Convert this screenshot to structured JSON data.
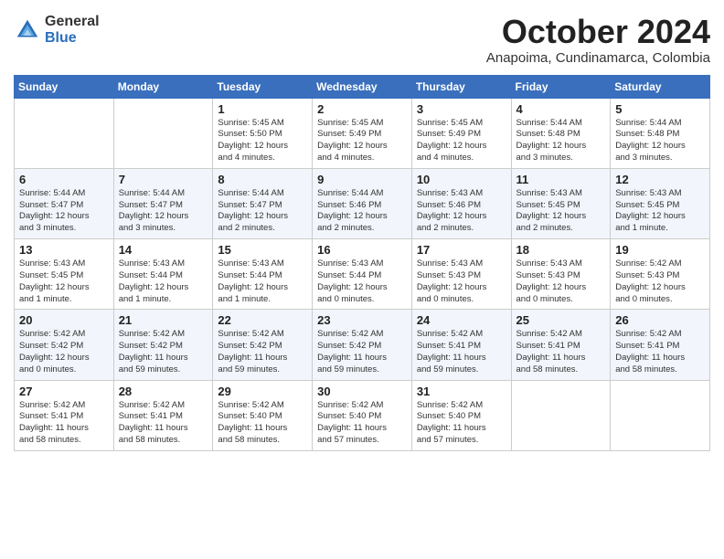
{
  "logo": {
    "general": "General",
    "blue": "Blue"
  },
  "title": "October 2024",
  "location": "Anapoima, Cundinamarca, Colombia",
  "weekdays": [
    "Sunday",
    "Monday",
    "Tuesday",
    "Wednesday",
    "Thursday",
    "Friday",
    "Saturday"
  ],
  "weeks": [
    [
      {
        "day": "",
        "detail": ""
      },
      {
        "day": "",
        "detail": ""
      },
      {
        "day": "1",
        "detail": "Sunrise: 5:45 AM\nSunset: 5:50 PM\nDaylight: 12 hours\nand 4 minutes."
      },
      {
        "day": "2",
        "detail": "Sunrise: 5:45 AM\nSunset: 5:49 PM\nDaylight: 12 hours\nand 4 minutes."
      },
      {
        "day": "3",
        "detail": "Sunrise: 5:45 AM\nSunset: 5:49 PM\nDaylight: 12 hours\nand 4 minutes."
      },
      {
        "day": "4",
        "detail": "Sunrise: 5:44 AM\nSunset: 5:48 PM\nDaylight: 12 hours\nand 3 minutes."
      },
      {
        "day": "5",
        "detail": "Sunrise: 5:44 AM\nSunset: 5:48 PM\nDaylight: 12 hours\nand 3 minutes."
      }
    ],
    [
      {
        "day": "6",
        "detail": "Sunrise: 5:44 AM\nSunset: 5:47 PM\nDaylight: 12 hours\nand 3 minutes."
      },
      {
        "day": "7",
        "detail": "Sunrise: 5:44 AM\nSunset: 5:47 PM\nDaylight: 12 hours\nand 3 minutes."
      },
      {
        "day": "8",
        "detail": "Sunrise: 5:44 AM\nSunset: 5:47 PM\nDaylight: 12 hours\nand 2 minutes."
      },
      {
        "day": "9",
        "detail": "Sunrise: 5:44 AM\nSunset: 5:46 PM\nDaylight: 12 hours\nand 2 minutes."
      },
      {
        "day": "10",
        "detail": "Sunrise: 5:43 AM\nSunset: 5:46 PM\nDaylight: 12 hours\nand 2 minutes."
      },
      {
        "day": "11",
        "detail": "Sunrise: 5:43 AM\nSunset: 5:45 PM\nDaylight: 12 hours\nand 2 minutes."
      },
      {
        "day": "12",
        "detail": "Sunrise: 5:43 AM\nSunset: 5:45 PM\nDaylight: 12 hours\nand 1 minute."
      }
    ],
    [
      {
        "day": "13",
        "detail": "Sunrise: 5:43 AM\nSunset: 5:45 PM\nDaylight: 12 hours\nand 1 minute."
      },
      {
        "day": "14",
        "detail": "Sunrise: 5:43 AM\nSunset: 5:44 PM\nDaylight: 12 hours\nand 1 minute."
      },
      {
        "day": "15",
        "detail": "Sunrise: 5:43 AM\nSunset: 5:44 PM\nDaylight: 12 hours\nand 1 minute."
      },
      {
        "day": "16",
        "detail": "Sunrise: 5:43 AM\nSunset: 5:44 PM\nDaylight: 12 hours\nand 0 minutes."
      },
      {
        "day": "17",
        "detail": "Sunrise: 5:43 AM\nSunset: 5:43 PM\nDaylight: 12 hours\nand 0 minutes."
      },
      {
        "day": "18",
        "detail": "Sunrise: 5:43 AM\nSunset: 5:43 PM\nDaylight: 12 hours\nand 0 minutes."
      },
      {
        "day": "19",
        "detail": "Sunrise: 5:42 AM\nSunset: 5:43 PM\nDaylight: 12 hours\nand 0 minutes."
      }
    ],
    [
      {
        "day": "20",
        "detail": "Sunrise: 5:42 AM\nSunset: 5:42 PM\nDaylight: 12 hours\nand 0 minutes."
      },
      {
        "day": "21",
        "detail": "Sunrise: 5:42 AM\nSunset: 5:42 PM\nDaylight: 11 hours\nand 59 minutes."
      },
      {
        "day": "22",
        "detail": "Sunrise: 5:42 AM\nSunset: 5:42 PM\nDaylight: 11 hours\nand 59 minutes."
      },
      {
        "day": "23",
        "detail": "Sunrise: 5:42 AM\nSunset: 5:42 PM\nDaylight: 11 hours\nand 59 minutes."
      },
      {
        "day": "24",
        "detail": "Sunrise: 5:42 AM\nSunset: 5:41 PM\nDaylight: 11 hours\nand 59 minutes."
      },
      {
        "day": "25",
        "detail": "Sunrise: 5:42 AM\nSunset: 5:41 PM\nDaylight: 11 hours\nand 58 minutes."
      },
      {
        "day": "26",
        "detail": "Sunrise: 5:42 AM\nSunset: 5:41 PM\nDaylight: 11 hours\nand 58 minutes."
      }
    ],
    [
      {
        "day": "27",
        "detail": "Sunrise: 5:42 AM\nSunset: 5:41 PM\nDaylight: 11 hours\nand 58 minutes."
      },
      {
        "day": "28",
        "detail": "Sunrise: 5:42 AM\nSunset: 5:41 PM\nDaylight: 11 hours\nand 58 minutes."
      },
      {
        "day": "29",
        "detail": "Sunrise: 5:42 AM\nSunset: 5:40 PM\nDaylight: 11 hours\nand 58 minutes."
      },
      {
        "day": "30",
        "detail": "Sunrise: 5:42 AM\nSunset: 5:40 PM\nDaylight: 11 hours\nand 57 minutes."
      },
      {
        "day": "31",
        "detail": "Sunrise: 5:42 AM\nSunset: 5:40 PM\nDaylight: 11 hours\nand 57 minutes."
      },
      {
        "day": "",
        "detail": ""
      },
      {
        "day": "",
        "detail": ""
      }
    ]
  ]
}
